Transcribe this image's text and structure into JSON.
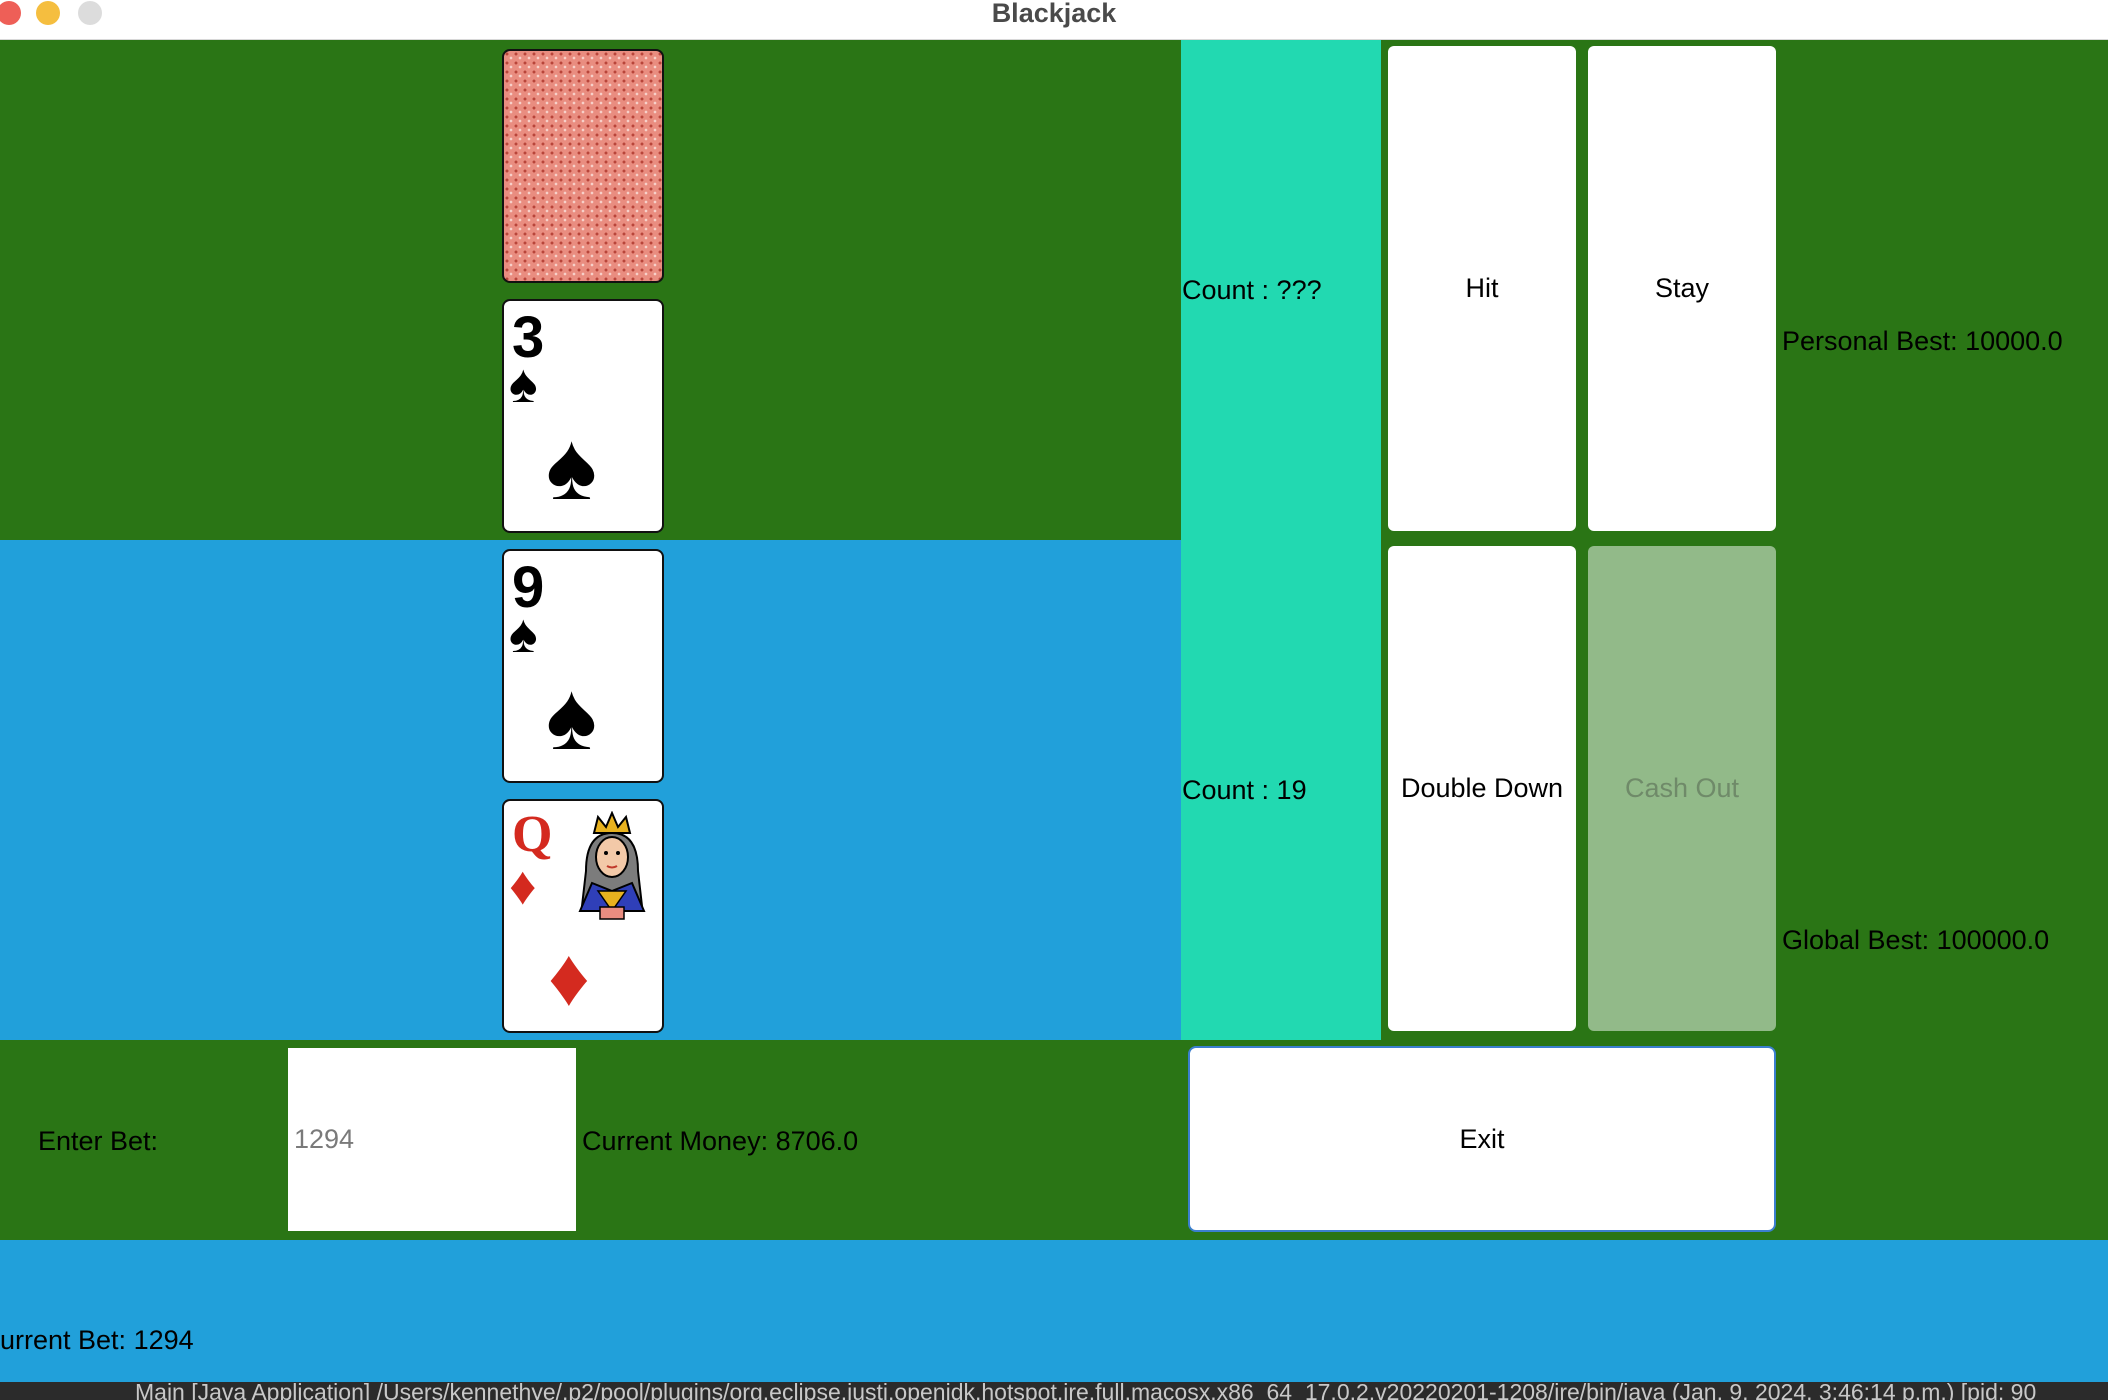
{
  "window": {
    "title": "Blackjack"
  },
  "dealer": {
    "count_label": "Count : ???",
    "cards": [
      {
        "face": "back"
      },
      {
        "rank": "3",
        "suit": "♠",
        "color": "#000000"
      }
    ]
  },
  "player": {
    "count_label": "Count : 19",
    "cards": [
      {
        "rank": "9",
        "suit": "♠",
        "color": "#000000"
      },
      {
        "rank": "Q",
        "suit": "♦",
        "color": "#d42a1f"
      }
    ]
  },
  "buttons": {
    "hit": "Hit",
    "stay": "Stay",
    "double_down": "Double Down",
    "cash_out": "Cash Out",
    "exit": "Exit"
  },
  "stats": {
    "personal_best": "Personal Best: 10000.0",
    "global_best": "Global Best: 100000.0",
    "current_money": "Current Money: 8706.0",
    "current_bet": "urrent Bet: 1294"
  },
  "bet": {
    "label": "Enter Bet:",
    "value": "1294"
  },
  "statusbar": {
    "text": "Main [Java Application] /Users/kennethye/.p2/pool/plugins/org.eclipse.justj.openjdk.hotspot.jre.full.macosx.x86_64_17.0.2.v20220201-1208/jre/bin/java  (Jan. 9, 2024, 3:46:14 p.m.) [pid: 90"
  },
  "colors": {
    "table_green": "#2a7515",
    "player_blue": "#21a0da",
    "count_teal": "#22d9b1",
    "disabled_button": "#92ba89"
  }
}
